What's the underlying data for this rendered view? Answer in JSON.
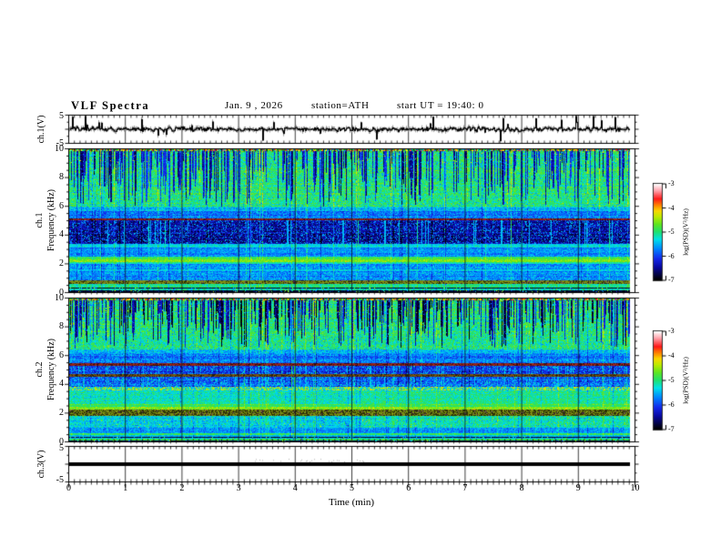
{
  "header": {
    "title": "VLF Spectra",
    "date": "Jan. 9 , 2026",
    "station": "station=ATH",
    "start_ut": "start UT =  19:40: 0"
  },
  "xaxis": {
    "label": "Time (min)",
    "tick_labels": [
      "0",
      "1",
      "2",
      "3",
      "4",
      "5",
      "6",
      "7",
      "8",
      "9",
      "10"
    ],
    "range_min": [
      0,
      10
    ],
    "minor_tick_step_min": 0.1
  },
  "panels": {
    "ch1_wave": {
      "ylabel": "ch.1(V)",
      "ytick_labels": [
        "5",
        "-5"
      ],
      "y_range": [
        -5,
        5
      ]
    },
    "spec1": {
      "ylabel_channel": "ch.1",
      "ylabel_axis": "Frequency (kHz)",
      "ytick_labels": [
        "10",
        "8",
        "6",
        "4",
        "2",
        "0"
      ],
      "y_range_kHz": [
        0,
        10
      ]
    },
    "spec2": {
      "ylabel_channel": "ch.2",
      "ylabel_axis": "Frequency (kHz)",
      "ytick_labels": [
        "10",
        "8",
        "6",
        "4",
        "2",
        "0"
      ],
      "y_range_kHz": [
        0,
        10
      ]
    },
    "ch3_wave": {
      "ylabel": "ch.3(V)",
      "ytick_labels": [
        "5",
        "-5"
      ],
      "y_range": [
        -5,
        5
      ]
    }
  },
  "colorbars": [
    {
      "label": "log(PSD)(V²/Hz)",
      "tick_labels": [
        "-3",
        "-4",
        "-5",
        "-6",
        "-7"
      ],
      "z_range": [
        -7,
        -3
      ]
    },
    {
      "label": "log(PSD)(V²/Hz)",
      "tick_labels": [
        "-3",
        "-4",
        "-5",
        "-6",
        "-7"
      ],
      "z_range": [
        -7,
        -3
      ]
    }
  ],
  "colormap": {
    "stops": [
      [
        0.0,
        [
          0,
          0,
          0
        ]
      ],
      [
        0.13,
        [
          8,
          8,
          160
        ]
      ],
      [
        0.22,
        [
          20,
          40,
          235
        ]
      ],
      [
        0.32,
        [
          0,
          130,
          255
        ]
      ],
      [
        0.42,
        [
          0,
          225,
          235
        ]
      ],
      [
        0.5,
        [
          30,
          225,
          110
        ]
      ],
      [
        0.58,
        [
          95,
          230,
          30
        ]
      ],
      [
        0.66,
        [
          190,
          235,
          0
        ]
      ],
      [
        0.72,
        [
          250,
          215,
          0
        ]
      ],
      [
        0.78,
        [
          255,
          130,
          0
        ]
      ],
      [
        0.845,
        [
          255,
          25,
          25
        ]
      ],
      [
        0.93,
        [
          255,
          160,
          170
        ]
      ],
      [
        1.0,
        [
          255,
          255,
          255
        ]
      ]
    ]
  },
  "chart_data": [
    {
      "panel": "ch.1 waveform",
      "type": "line",
      "ylabel": "ch.1(V)",
      "x_range_min": [
        0,
        10
      ],
      "y_range_V": [
        -5,
        5
      ],
      "data_end_min": 9.9,
      "signal": {
        "mean_V": 0,
        "typical_noise_V": 0.9,
        "spike_amplitude_V": 4.4,
        "spike_prob_per_sample": 0.045,
        "seed": 77031
      }
    },
    {
      "panel": "ch.1 spectrogram",
      "type": "heatmap",
      "ylabel": "Frequency (kHz)",
      "x_range_min": [
        0,
        10
      ],
      "y_range_kHz": [
        0,
        10
      ],
      "data_end_min": 9.9,
      "z_label": "log(PSD)(V²/Hz)",
      "z_range": [
        -7,
        -3
      ],
      "seed": 11,
      "column_effects": {
        "streak_prob": 0.45,
        "streak_bottom_kHz": [
          6.0,
          9.4
        ],
        "accent_prob": 0.1,
        "cyan_column_prob": 0.07
      },
      "bands": [
        {
          "f": [
            9.85,
            10.0
          ],
          "style": "rainbow-speckle"
        },
        {
          "f": [
            6.0,
            9.85
          ],
          "style": "green-with-streaks",
          "level": -5.0,
          "sigma": 0.3,
          "streak_level": -6.5,
          "warm_dot_prob": 0.012
        },
        {
          "f": [
            5.7,
            6.0
          ],
          "style": "speckle",
          "level": -5.45,
          "sigma": 0.3
        },
        {
          "f": [
            5.15,
            5.7
          ],
          "style": "speckle",
          "level": -5.8,
          "sigma": 0.3
        },
        {
          "f": [
            5.02,
            5.15
          ],
          "style": "maroon-row"
        },
        {
          "f": [
            3.35,
            5.02
          ],
          "style": "dark-speckle",
          "level": -6.5,
          "sigma": 0.3,
          "fleck_level": -5.6,
          "fleck_prob": 0.17
        },
        {
          "f": [
            3.12,
            3.35
          ],
          "style": "speckle",
          "level": -5.25,
          "sigma": 0.2
        },
        {
          "f": [
            2.5,
            3.12
          ],
          "style": "speckle",
          "level": -5.7,
          "sigma": 0.25
        },
        {
          "f": [
            2.32,
            2.5
          ],
          "style": "speckle",
          "level": -4.9,
          "sigma": 0.2
        },
        {
          "f": [
            2.1,
            2.32
          ],
          "style": "warm-row",
          "level": -4.6,
          "warm_prob": 0.12
        },
        {
          "f": [
            1.95,
            2.1
          ],
          "style": "speckle",
          "level": -5.1,
          "sigma": 0.2
        },
        {
          "f": [
            1.62,
            1.95
          ],
          "style": "speckle",
          "level": -5.65,
          "sigma": 0.28
        },
        {
          "f": [
            1.45,
            1.62
          ],
          "style": "speckle",
          "level": -5.35,
          "sigma": 0.2
        },
        {
          "f": [
            0.8,
            1.45
          ],
          "style": "speckle",
          "level": -5.68,
          "sigma": 0.28
        },
        {
          "f": [
            0.55,
            0.8
          ],
          "style": "olive-row",
          "dark_prob": 0.3
        },
        {
          "f": [
            0.35,
            0.55
          ],
          "style": "speckle",
          "level": -5.05,
          "sigma": 0.22
        },
        {
          "f": [
            0.0,
            0.35
          ],
          "style": "dark-bottom",
          "speckle_prob": 0.12,
          "lines": [
            {
              "f": 0.18,
              "level": -5.2
            }
          ]
        }
      ]
    },
    {
      "panel": "ch.2 spectrogram",
      "type": "heatmap",
      "ylabel": "Frequency (kHz)",
      "x_range_min": [
        0,
        10
      ],
      "y_range_kHz": [
        0,
        10
      ],
      "data_end_min": 9.9,
      "z_label": "log(PSD)(V²/Hz)",
      "z_range": [
        -7,
        -3
      ],
      "seed": 22,
      "column_effects": {
        "streak_prob": 0.5,
        "streak_bottom_kHz": [
          6.5,
          9.4
        ],
        "accent_prob": 0.1,
        "cyan_column_prob": 0.05
      },
      "bands": [
        {
          "f": [
            9.85,
            10.0
          ],
          "style": "rainbow-speckle"
        },
        {
          "f": [
            6.45,
            9.85
          ],
          "style": "green-with-streaks",
          "level": -5.0,
          "sigma": 0.3,
          "streak_level": -6.8,
          "warm_dot_prob": 0.01
        },
        {
          "f": [
            6.1,
            6.45
          ],
          "style": "speckle",
          "level": -5.5,
          "sigma": 0.28
        },
        {
          "f": [
            5.45,
            6.1
          ],
          "style": "speckle",
          "level": -5.75,
          "sigma": 0.3
        },
        {
          "f": [
            5.3,
            5.45
          ],
          "style": "maroon-row"
        },
        {
          "f": [
            4.72,
            5.3
          ],
          "style": "dark-speckle",
          "level": -6.05,
          "sigma": 0.3,
          "fleck_level": -5.4,
          "fleck_prob": 0.15
        },
        {
          "f": [
            4.55,
            4.72
          ],
          "style": "dark-row"
        },
        {
          "f": [
            3.85,
            4.55
          ],
          "style": "dark-speckle",
          "level": -5.9,
          "sigma": 0.3,
          "fleck_level": -5.3,
          "fleck_prob": 0.15
        },
        {
          "f": [
            3.55,
            3.85
          ],
          "style": "warm-dotted",
          "level": -5.35,
          "warm_prob": 0.4
        },
        {
          "f": [
            2.62,
            3.55
          ],
          "style": "speckle",
          "level": -5.2,
          "sigma": 0.25,
          "right_boost": 0.15
        },
        {
          "f": [
            2.45,
            2.62
          ],
          "style": "speckle",
          "level": -4.85,
          "sigma": 0.2
        },
        {
          "f": [
            2.25,
            2.45
          ],
          "style": "warm-row",
          "level": -4.6,
          "warm_prob": 0.15
        },
        {
          "f": [
            1.8,
            2.25
          ],
          "style": "olive-row",
          "dark_prob": 0.45
        },
        {
          "f": [
            0.95,
            1.8
          ],
          "style": "speckle",
          "level": -5.35,
          "sigma": 0.3,
          "right_boost": 0.25,
          "warm_dot_prob": 0.01
        },
        {
          "f": [
            0.6,
            0.95
          ],
          "style": "speckle",
          "level": -5.6,
          "sigma": 0.25
        },
        {
          "f": [
            0.45,
            0.6
          ],
          "style": "speckle",
          "level": -5.0,
          "sigma": 0.2
        },
        {
          "f": [
            0.3,
            0.45
          ],
          "style": "speckle",
          "level": -5.45,
          "sigma": 0.2
        },
        {
          "f": [
            0.0,
            0.3
          ],
          "style": "dark-bottom",
          "speckle_prob": 0.1,
          "lines": [
            {
              "f": 0.22,
              "level": -5.5
            },
            {
              "f": 0.12,
              "level": -4.9
            }
          ]
        }
      ]
    },
    {
      "panel": "ch.3 waveform",
      "type": "line",
      "ylabel": "ch.3(V)",
      "x_range_min": [
        0,
        10
      ],
      "y_range_V": [
        -5,
        5
      ],
      "data_end_min": 9.9,
      "signal": {
        "constant_value_V": 0,
        "line_thickness_px": 4
      }
    }
  ]
}
